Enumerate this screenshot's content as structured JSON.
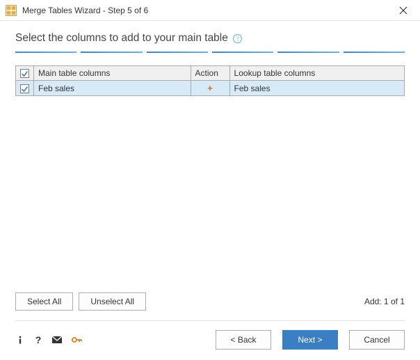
{
  "titlebar": {
    "title": "Merge Tables Wizard - Step 5 of 6"
  },
  "heading": "Select the columns to add to your main table",
  "columns": {
    "main": "Main table columns",
    "action": "Action",
    "lookup": "Lookup table columns"
  },
  "rows": [
    {
      "checked": true,
      "main": "Feb sales",
      "action": "+",
      "lookup": "Feb sales"
    }
  ],
  "buttons": {
    "select_all": "Select All",
    "unselect_all": "Unselect All",
    "back": "< Back",
    "next": "Next >",
    "cancel": "Cancel"
  },
  "add_status": "Add: 1 of 1"
}
